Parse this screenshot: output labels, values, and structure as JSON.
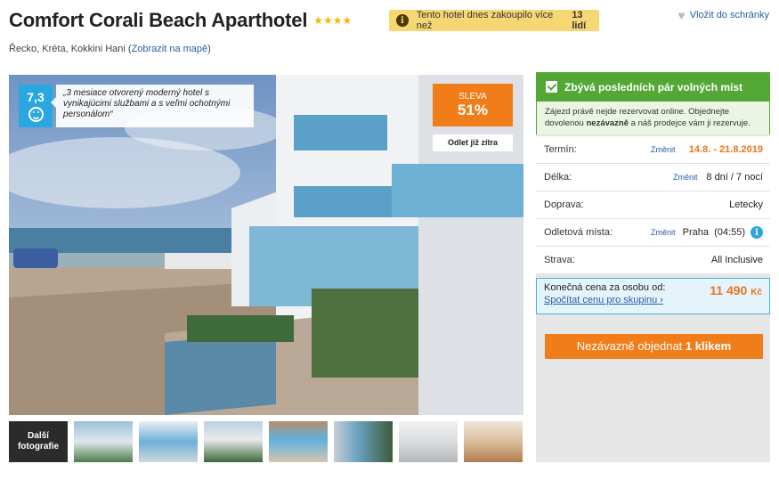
{
  "header": {
    "title": "Comfort Corali Beach Aparthotel",
    "stars": "★★★★",
    "buy_notice_text": "Tento hotel dnes zakoupilo více než",
    "buy_notice_count": "13 lidí",
    "wishlist_label": "Vložit do schránky"
  },
  "location": {
    "text": "Řecko, Kréta, Kokkini Hani (",
    "map_link": "Zobrazit na mapě",
    "close": ")"
  },
  "rating": {
    "score": "7,3",
    "quote": "„3 mesiace otvorený moderný hotel s vynikajúcimi službami a s veľmi ochotnými personálom“"
  },
  "discount": {
    "label": "SLEVA",
    "value": "51%"
  },
  "depart_button": "Odlet již zítra",
  "gallery": {
    "more_label_line1": "Další",
    "more_label_line2": "fotografie",
    "thumbnail_count": 7
  },
  "panel": {
    "header": "Zbývá posledních pár volných míst",
    "notice_part1": "Zájezd právě nejde rezervovat online. Objednejte dovolenou ",
    "notice_bold": "nezávazně",
    "notice_part2": " a náš prodejce vám ji rezervuje.",
    "rows": [
      {
        "key": "Termín:",
        "change": "Změnit",
        "value": "14.8. - 21.8.2019"
      },
      {
        "key": "Délka:",
        "change": "Změnit",
        "value": "8 dní / 7 nocí"
      },
      {
        "key": "Doprava:",
        "value": "Letecky"
      },
      {
        "key": "Odletová místa:",
        "change": "Změnit",
        "value": "Praha  (04:55)"
      },
      {
        "key": "Strava:",
        "value": "All Inclusive"
      }
    ],
    "price_label": "Konečná cena za osobu od:",
    "price_value": "11 490",
    "price_currency": "Kč",
    "group_link": "Spočítat cenu pro skupinu",
    "order_text": "Nezávazně objednat ",
    "order_bold": "1 klikem"
  },
  "colors": {
    "accent_orange": "#f07d1a",
    "green": "#53a835",
    "blue": "#2aa7e0",
    "link": "#2a5ca8"
  }
}
